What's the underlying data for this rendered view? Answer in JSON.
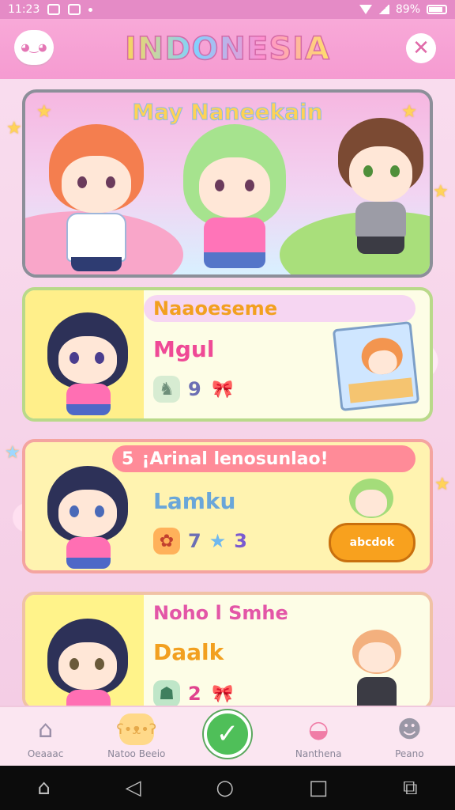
{
  "status_bar": {
    "time": "11:23",
    "battery": "89%",
    "icons": [
      "app-notification-icon",
      "app-notification-icon",
      "dot-icon",
      "wifi-icon",
      "signal-icon",
      "battery-icon"
    ]
  },
  "header": {
    "title": "INDONESIA",
    "left_icon": "cloud-mascot-icon",
    "close_icon": "close-icon",
    "close_glyph": "✕",
    "left_glyph": "◕‿◕"
  },
  "feature_card": {
    "title": "May Naneekain"
  },
  "cards": [
    {
      "heading": "Naaoeseme",
      "name": "Mgul",
      "stat_value": "9",
      "stat_icon_glyph": "♞",
      "bow_glyph": "🎀"
    },
    {
      "heading": "¡Arinal lenosunlao!",
      "heading_prefix": "5",
      "name": "Lamku",
      "stat_value": "7",
      "stat_extra": "3",
      "stat_icon_glyph": "✿",
      "star_glyph": "★",
      "thumb_text": "abcdok"
    },
    {
      "heading": "Noho l Smhe",
      "name": "Daalk",
      "stat_value": "2",
      "stat_icon_glyph": "☗",
      "bow_glyph": "🎀"
    }
  ],
  "bottom_nav": {
    "items": [
      {
        "label": "Oeaaac",
        "icon": "house-icon",
        "glyph": "⌂"
      },
      {
        "label": "Natoo Beeio",
        "icon": "bear-icon",
        "glyph": "ʕ•ᴥ•ʔ"
      },
      {
        "label": "",
        "icon": "check-icon",
        "glyph": "✓"
      },
      {
        "label": "Nanthena",
        "icon": "cake-icon",
        "glyph": "◒"
      },
      {
        "label": "Peano",
        "icon": "character-icon",
        "glyph": "☻"
      }
    ]
  },
  "system_nav": {
    "home_glyph": "⌂",
    "back_glyph": "◁",
    "circle_glyph": "○",
    "square_glyph": "□",
    "screenshot_glyph": "⧉"
  },
  "colors": {
    "header_pink": "#f59bd1",
    "status_pink": "#e58bc6",
    "card1_accent": "#ffef8a",
    "card2_heading": "#ff8b98",
    "card3_accent": "#fff38a",
    "check_green": "#4fbf59"
  }
}
